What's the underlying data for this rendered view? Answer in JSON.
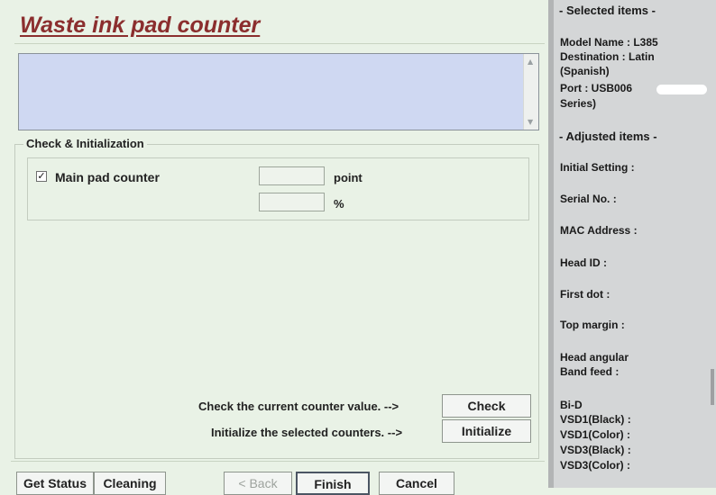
{
  "window": {
    "title": "Waste ink pad counter"
  },
  "group": {
    "legend": "Check & Initialization",
    "counter": {
      "checked": true,
      "check_mark": "✓",
      "label": "Main pad counter",
      "point_value": "",
      "point_unit": "point",
      "percent_value": "",
      "percent_unit": "%"
    }
  },
  "actions": {
    "check_hint": "Check the current counter value. -->",
    "check_label": "Check",
    "init_hint": "Initialize the selected counters. -->",
    "init_label": "Initialize"
  },
  "footer": {
    "get_status": "Get Status",
    "cleaning": "Cleaning",
    "back": "< Back",
    "finish": "Finish",
    "cancel": "Cancel"
  },
  "side_panel": {
    "selected_header": "- Selected items -",
    "model": "Model Name : L385",
    "destination_1": "Destination : Latin",
    "destination_2": "(Spanish)",
    "port_1": "Port : USB006",
    "port_2": "Series)",
    "adjusted_header": "- Adjusted items -",
    "initial_setting": "Initial Setting :",
    "serial_no": "Serial No. :",
    "mac_address": "MAC Address :",
    "head_id": "Head ID :",
    "first_dot": "First dot :",
    "top_margin": "Top margin :",
    "head_angular_1": "Head angular",
    "head_angular_2": " Band feed :",
    "bid": "Bi-D",
    "vsd1_black": " VSD1(Black) :",
    "vsd1_color": " VSD1(Color) :",
    "vsd3_black": " VSD3(Black) :",
    "vsd3_color": " VSD3(Color) :"
  },
  "colors": {
    "dialog_bg": "#e9f2e6",
    "title": "#8b2e2e",
    "textarea_bg": "#cfd8f2",
    "panel_bg": "#d4d6d7"
  },
  "icons": {
    "scroll_up": "▲",
    "scroll_down": "▼"
  }
}
